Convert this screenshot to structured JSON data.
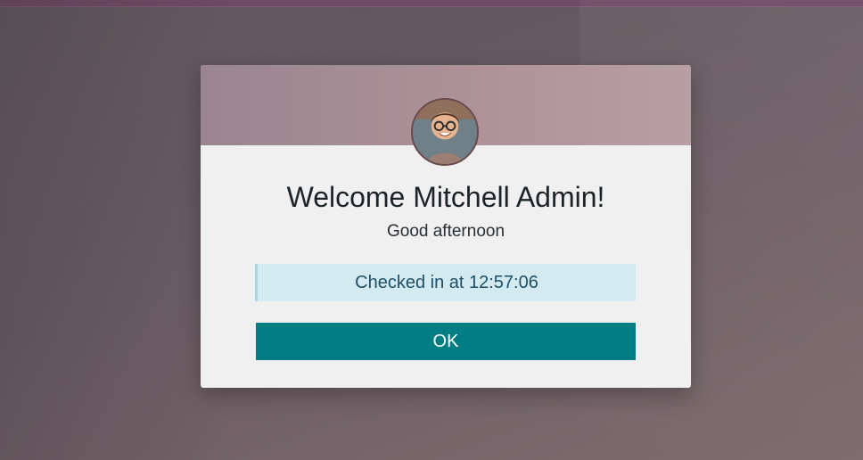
{
  "modal": {
    "title": "Welcome Mitchell Admin!",
    "subtitle": "Good afternoon",
    "status": "Checked in at 12:57:06",
    "button_label": "OK"
  },
  "colors": {
    "primary": "#017e84",
    "status_bg": "#d2eaf0",
    "header_accent": "#b89fa3"
  },
  "icons": {
    "avatar": "user-avatar"
  }
}
